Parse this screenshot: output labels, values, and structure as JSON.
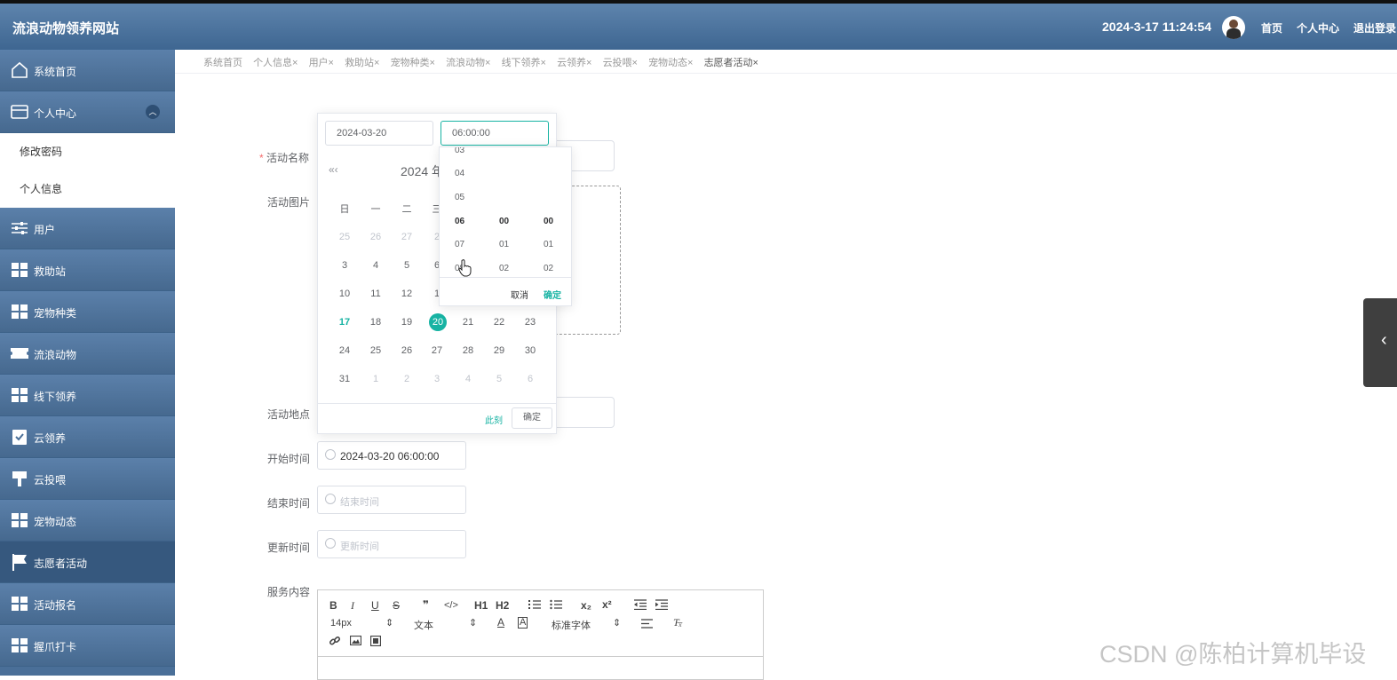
{
  "header": {
    "title": "流浪动物领养网站",
    "datetime": "2024-3-17 11:24:54",
    "nav": [
      "首页",
      "个人中心",
      "退出登录"
    ]
  },
  "sidebar": {
    "items": [
      {
        "label": "系统首页",
        "icon": "home-icon"
      },
      {
        "label": "个人中心",
        "icon": "wallet-icon",
        "expanded": true,
        "sub": [
          "修改密码",
          "个人信息"
        ]
      },
      {
        "label": "用户",
        "icon": "sliders-icon"
      },
      {
        "label": "救助站",
        "icon": "grid-icon"
      },
      {
        "label": "宠物种类",
        "icon": "grid-icon"
      },
      {
        "label": "流浪动物",
        "icon": "ticket-icon"
      },
      {
        "label": "线下领养",
        "icon": "grid-icon"
      },
      {
        "label": "云领养",
        "icon": "clipboard-icon"
      },
      {
        "label": "云投喂",
        "icon": "brush-icon"
      },
      {
        "label": "宠物动态",
        "icon": "grid-icon"
      },
      {
        "label": "志愿者活动",
        "icon": "flag-icon",
        "active": true
      },
      {
        "label": "活动报名",
        "icon": "grid-icon"
      },
      {
        "label": "握爪打卡",
        "icon": "grid-icon"
      }
    ]
  },
  "tabs": [
    "系统首页",
    "个人信息×",
    "用户×",
    "救助站×",
    "宠物种类×",
    "流浪动物×",
    "线下领养×",
    "云领养×",
    "云投喂×",
    "宠物动态×",
    "志愿者活动×"
  ],
  "form": {
    "required_mark": "*",
    "labels": {
      "name": "活动名称",
      "image": "活动图片",
      "place": "活动地点",
      "start": "开始时间",
      "end": "结束时间",
      "update": "更新时间",
      "content": "服务内容"
    },
    "start_value": "2024-03-20 06:00:00",
    "end_placeholder": "结束时间",
    "update_placeholder": "更新时间"
  },
  "datepicker": {
    "date_input": "2024-03-20",
    "time_input": "06:00:00",
    "nav_prev": "«‹",
    "year_month": "2024 年",
    "weekdays": [
      "日",
      "一",
      "二",
      "三"
    ],
    "rows": [
      [
        "25",
        "26",
        "27",
        "2"
      ],
      [
        "3",
        "4",
        "5",
        "6"
      ],
      [
        "10",
        "11",
        "12",
        "1"
      ],
      [
        "17",
        "18",
        "19",
        "20",
        "21",
        "22",
        "23"
      ],
      [
        "24",
        "25",
        "26",
        "27",
        "28",
        "29",
        "30"
      ],
      [
        "31",
        "1",
        "2",
        "3",
        "4",
        "5",
        "6"
      ]
    ],
    "today": "17",
    "selected": "20",
    "now_label": "此刻",
    "ok_label": "确定"
  },
  "timepicker": {
    "hours": [
      "03",
      "04",
      "05",
      "06",
      "07",
      "08"
    ],
    "minutes": [
      "00",
      "01",
      "02"
    ],
    "seconds": [
      "00",
      "01",
      "02"
    ],
    "cancel": "取消",
    "confirm": "确定"
  },
  "editor": {
    "font_size": "14px",
    "header_select": "文本",
    "font_family": "标准字体",
    "buttons": [
      "B",
      "I",
      "U",
      "S",
      "❞",
      "</>",
      "H1",
      "H2",
      "ordered-list",
      "bullet-list",
      "x₂",
      "x²",
      "outdent",
      "indent"
    ]
  },
  "watermark": "CSDN @陈柏计算机毕设",
  "colors": {
    "accent": "#17b3a3",
    "sidebar": "#4a6f98",
    "header": "#4a719a"
  }
}
